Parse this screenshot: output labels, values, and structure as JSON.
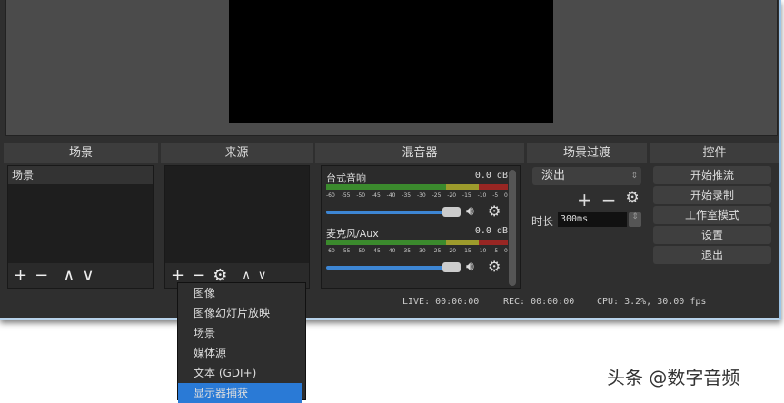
{
  "docks": {
    "scenes": "场景",
    "sources": "来源",
    "mixer": "混音器",
    "transitions": "场景过渡",
    "controls": "控件"
  },
  "scenes": {
    "items": [
      "场景"
    ]
  },
  "mixer": {
    "channels": [
      {
        "name": "台式音响",
        "db": "0.0 dB"
      },
      {
        "name": "麦克风/Aux",
        "db": "0.0 dB"
      }
    ],
    "ticks": [
      "-60",
      "-55",
      "-50",
      "-45",
      "-40",
      "-35",
      "-30",
      "-25",
      "-20",
      "-15",
      "-10",
      "-5",
      "0"
    ]
  },
  "transitions": {
    "selected": "淡出",
    "duration_label": "时长",
    "duration": "300ms"
  },
  "controls": {
    "buttons": [
      "开始推流",
      "开始录制",
      "工作室模式",
      "设置",
      "退出"
    ]
  },
  "status": {
    "live": "LIVE: 00:00:00",
    "rec": "REC: 00:00:00",
    "cpu": "CPU: 3.2%, 30.00 fps"
  },
  "menu": {
    "items": [
      "图像",
      "图像幻灯片放映",
      "场景",
      "媒体源",
      "文本 (GDI+)",
      "显示器捕获"
    ],
    "selected_index": 5
  },
  "watermark": "头条 @数字音频"
}
